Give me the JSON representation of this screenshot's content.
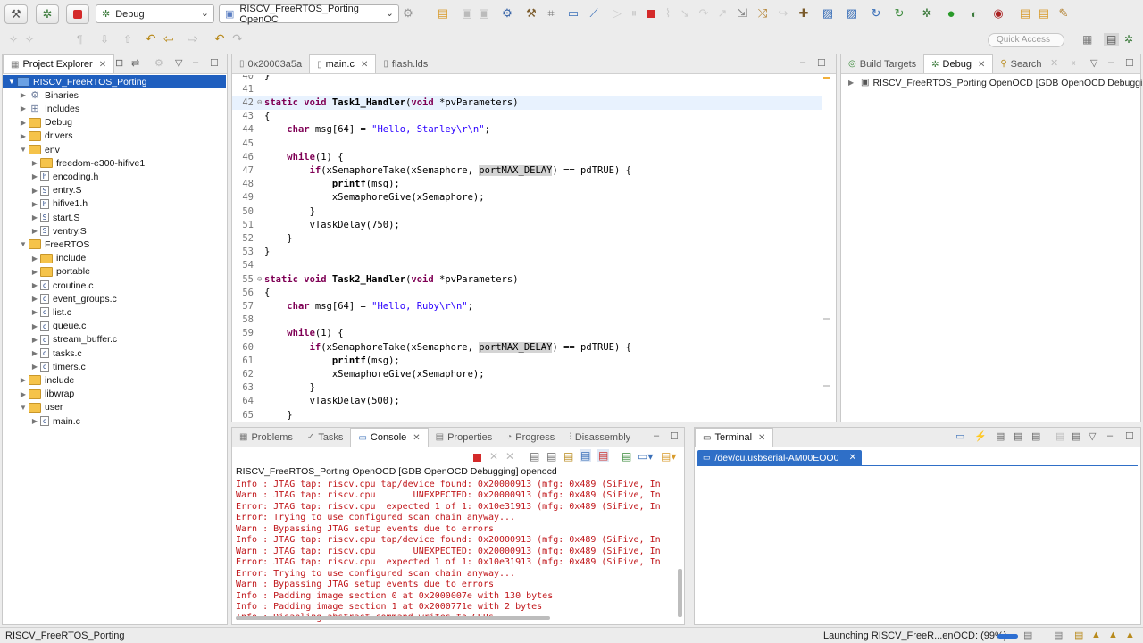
{
  "toolbar": {
    "launch_mode": "Debug",
    "launch_config": "RISCV_FreeRTOS_Porting OpenOC",
    "quick_access_placeholder": "Quick Access"
  },
  "project_explorer": {
    "tab_label": "Project Explorer",
    "items": [
      {
        "label": "RISCV_FreeRTOS_Porting",
        "depth": 0,
        "kind": "project",
        "expanded": true,
        "selected": true
      },
      {
        "label": "Binaries",
        "depth": 1,
        "kind": "binaries",
        "expanded": false
      },
      {
        "label": "Includes",
        "depth": 1,
        "kind": "includes",
        "expanded": false
      },
      {
        "label": "Debug",
        "depth": 1,
        "kind": "folder",
        "expanded": false
      },
      {
        "label": "drivers",
        "depth": 1,
        "kind": "folder",
        "expanded": false
      },
      {
        "label": "env",
        "depth": 1,
        "kind": "folder",
        "expanded": true
      },
      {
        "label": "freedom-e300-hifive1",
        "depth": 2,
        "kind": "folder",
        "expanded": false
      },
      {
        "label": "encoding.h",
        "depth": 2,
        "kind": "h",
        "expanded": false
      },
      {
        "label": "entry.S",
        "depth": 2,
        "kind": "S",
        "expanded": false
      },
      {
        "label": "hifive1.h",
        "depth": 2,
        "kind": "h",
        "expanded": false
      },
      {
        "label": "start.S",
        "depth": 2,
        "kind": "S",
        "expanded": false
      },
      {
        "label": "ventry.S",
        "depth": 2,
        "kind": "S",
        "expanded": false
      },
      {
        "label": "FreeRTOS",
        "depth": 1,
        "kind": "folder",
        "expanded": true
      },
      {
        "label": "include",
        "depth": 2,
        "kind": "folder",
        "expanded": false
      },
      {
        "label": "portable",
        "depth": 2,
        "kind": "folder",
        "expanded": false
      },
      {
        "label": "croutine.c",
        "depth": 2,
        "kind": "c",
        "expanded": false
      },
      {
        "label": "event_groups.c",
        "depth": 2,
        "kind": "c",
        "expanded": false
      },
      {
        "label": "list.c",
        "depth": 2,
        "kind": "c",
        "expanded": false
      },
      {
        "label": "queue.c",
        "depth": 2,
        "kind": "c",
        "expanded": false
      },
      {
        "label": "stream_buffer.c",
        "depth": 2,
        "kind": "c",
        "expanded": false
      },
      {
        "label": "tasks.c",
        "depth": 2,
        "kind": "c",
        "expanded": false
      },
      {
        "label": "timers.c",
        "depth": 2,
        "kind": "c",
        "expanded": false
      },
      {
        "label": "include",
        "depth": 1,
        "kind": "folder",
        "expanded": false
      },
      {
        "label": "libwrap",
        "depth": 1,
        "kind": "folder",
        "expanded": false
      },
      {
        "label": "user",
        "depth": 1,
        "kind": "folder",
        "expanded": true
      },
      {
        "label": "main.c",
        "depth": 2,
        "kind": "c",
        "expanded": false
      }
    ]
  },
  "editor": {
    "tabs": [
      {
        "label": "0x20003a5a",
        "active": false
      },
      {
        "label": "main.c",
        "active": true
      },
      {
        "label": "flash.lds",
        "active": false
      }
    ],
    "lines": [
      {
        "n": "40",
        "text": "}"
      },
      {
        "n": "41",
        "text": ""
      },
      {
        "n": "42",
        "text": "static void Task1_Handler(void *pvParameters)"
      },
      {
        "n": "43",
        "text": "{"
      },
      {
        "n": "44",
        "text": "    char msg[64] = \"Hello, Stanley\\r\\n\";"
      },
      {
        "n": "45",
        "text": ""
      },
      {
        "n": "46",
        "text": "    while(1) {"
      },
      {
        "n": "47",
        "text": "        if(xSemaphoreTake(xSemaphore, portMAX_DELAY) == pdTRUE) {"
      },
      {
        "n": "48",
        "text": "            printf(msg);"
      },
      {
        "n": "49",
        "text": "            xSemaphoreGive(xSemaphore);"
      },
      {
        "n": "50",
        "text": "        }"
      },
      {
        "n": "51",
        "text": "        vTaskDelay(750);"
      },
      {
        "n": "52",
        "text": "    }"
      },
      {
        "n": "53",
        "text": "}"
      },
      {
        "n": "54",
        "text": ""
      },
      {
        "n": "55",
        "text": "static void Task2_Handler(void *pvParameters)"
      },
      {
        "n": "56",
        "text": "{"
      },
      {
        "n": "57",
        "text": "    char msg[64] = \"Hello, Ruby\\r\\n\";"
      },
      {
        "n": "58",
        "text": ""
      },
      {
        "n": "59",
        "text": "    while(1) {"
      },
      {
        "n": "60",
        "text": "        if(xSemaphoreTake(xSemaphore, portMAX_DELAY) == pdTRUE) {"
      },
      {
        "n": "61",
        "text": "            printf(msg);"
      },
      {
        "n": "62",
        "text": "            xSemaphoreGive(xSemaphore);"
      },
      {
        "n": "63",
        "text": "        }"
      },
      {
        "n": "64",
        "text": "        vTaskDelay(500);"
      },
      {
        "n": "65",
        "text": "    }"
      }
    ]
  },
  "debug_view": {
    "tabs": [
      "Build Targets",
      "Debug",
      "Search"
    ],
    "item": "RISCV_FreeRTOS_Porting OpenOCD [GDB OpenOCD Debugging]"
  },
  "console": {
    "tabs": [
      "Problems",
      "Tasks",
      "Console",
      "Properties",
      "Progress",
      "Disassembly"
    ],
    "title": "RISCV_FreeRTOS_Porting OpenOCD [GDB OpenOCD Debugging] openocd",
    "lines": [
      "Info : JTAG tap: riscv.cpu tap/device found: 0x20000913 (mfg: 0x489 (SiFive, In",
      "Warn : JTAG tap: riscv.cpu       UNEXPECTED: 0x20000913 (mfg: 0x489 (SiFive, In",
      "Error: JTAG tap: riscv.cpu  expected 1 of 1: 0x10e31913 (mfg: 0x489 (SiFive, In",
      "Error: Trying to use configured scan chain anyway...",
      "Warn : Bypassing JTAG setup events due to errors",
      "Info : JTAG tap: riscv.cpu tap/device found: 0x20000913 (mfg: 0x489 (SiFive, In",
      "Warn : JTAG tap: riscv.cpu       UNEXPECTED: 0x20000913 (mfg: 0x489 (SiFive, In",
      "Error: JTAG tap: riscv.cpu  expected 1 of 1: 0x10e31913 (mfg: 0x489 (SiFive, In",
      "Error: Trying to use configured scan chain anyway...",
      "Warn : Bypassing JTAG setup events due to errors",
      "Info : Padding image section 0 at 0x2000007e with 130 bytes",
      "Info : Padding image section 1 at 0x2000771e with 2 bytes",
      "Info : Disabling abstract command writes to CSRs."
    ]
  },
  "terminal": {
    "tab_label": "Terminal",
    "session_label": "/dev/cu.usbserial-AM00EOO0"
  },
  "status": {
    "left": "RISCV_FreeRTOS_Porting",
    "launching": "Launching RISCV_FreeR...enOCD: (99%)",
    "progress": 0.99
  },
  "colors": {
    "selection": "#1f5fbf",
    "console_error": "#c0161a",
    "keyword": "#7f0055",
    "string": "#2a00ff"
  }
}
